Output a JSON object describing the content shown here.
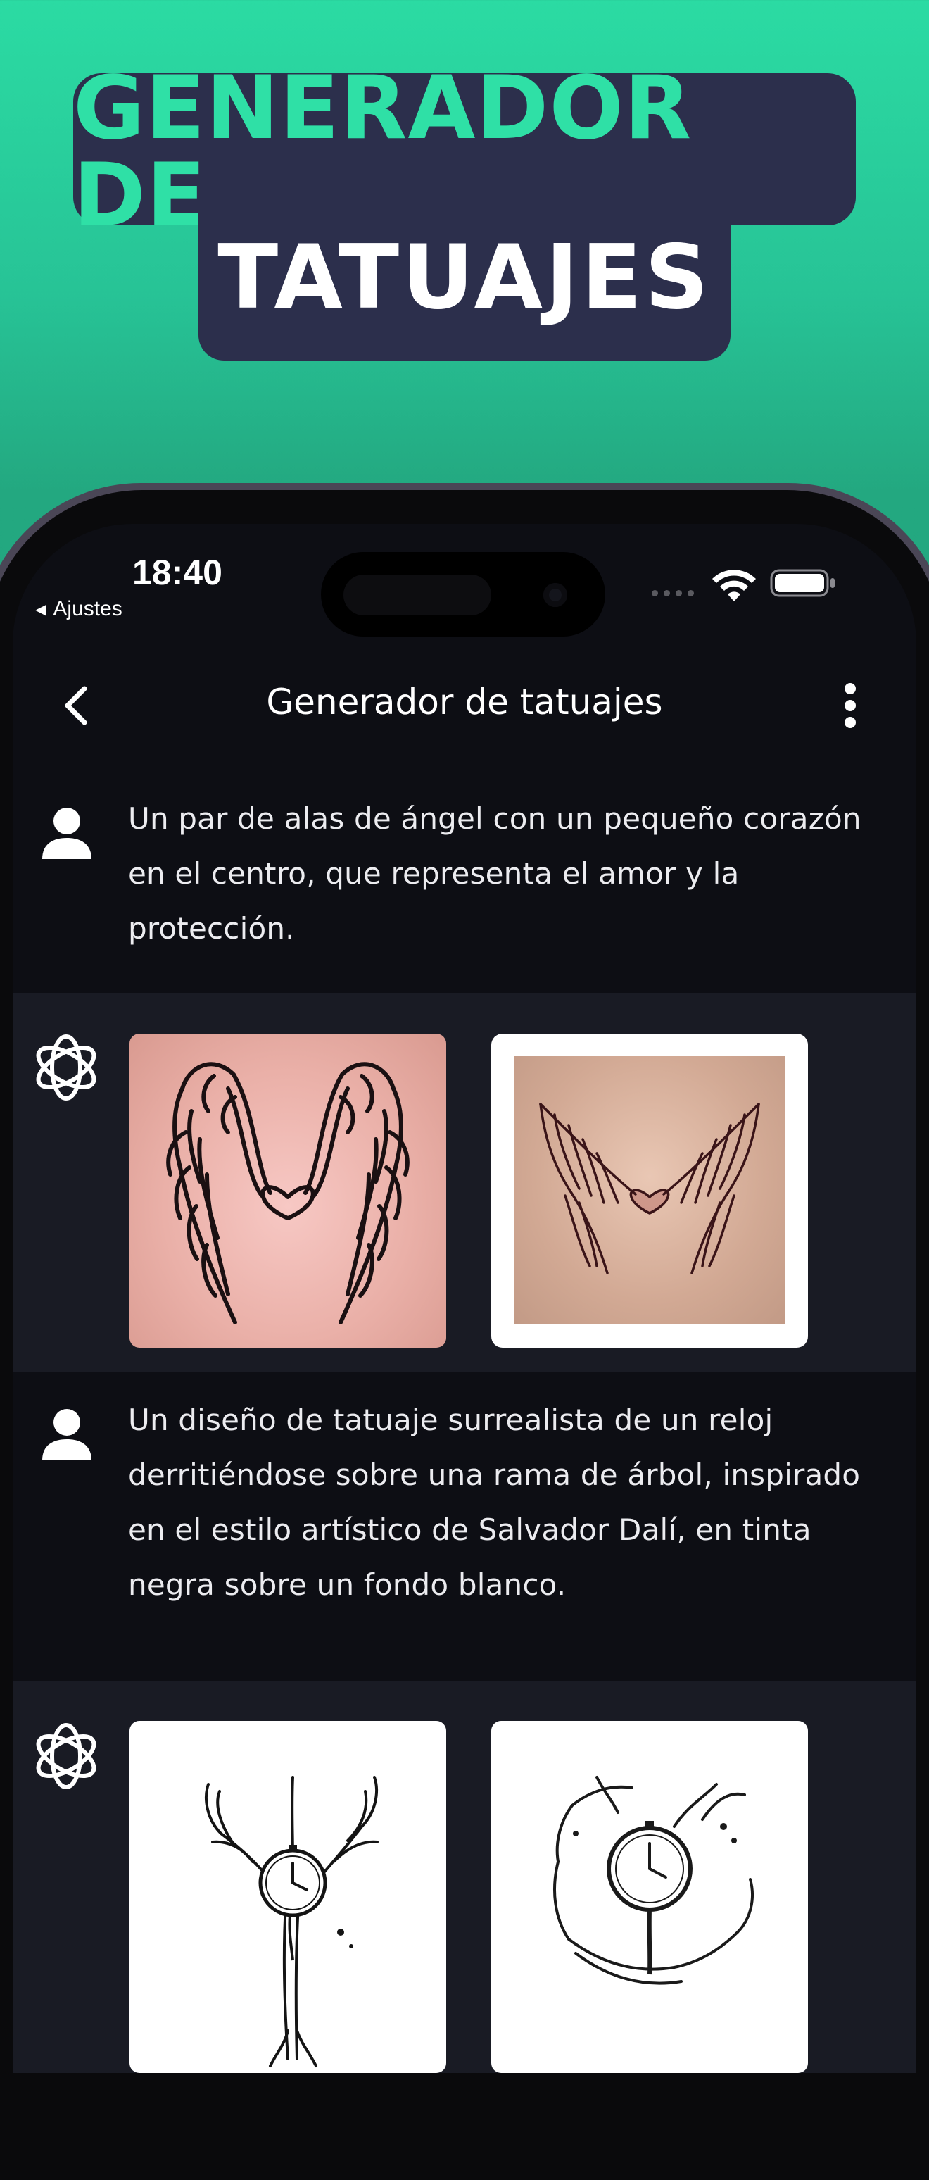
{
  "promo": {
    "headline_line1": "GENERADOR DE",
    "headline_line2": "TATUAJES"
  },
  "status_bar": {
    "time": "18:40",
    "back_app": "Ajustes"
  },
  "nav": {
    "title": "Generador de tatuajes"
  },
  "messages": [
    {
      "role": "user",
      "text": "Un par de alas de ángel con un pequeño corazón en el centro, que representa el amor y la protección."
    },
    {
      "role": "assistant",
      "images": [
        "angel-wings-tattoo-on-skin",
        "angel-wings-tattoo-framed"
      ]
    },
    {
      "role": "user",
      "text": "Un diseño de tatuaje surrealista de un reloj derritiéndose sobre una rama de árbol, inspirado en el estilo artístico de Salvador Dalí, en tinta negra sobre un fondo blanco."
    },
    {
      "role": "assistant",
      "images": [
        "melting-clock-tree-tattoo-1",
        "melting-clock-tree-tattoo-2"
      ]
    }
  ],
  "colors": {
    "background_top": "#2bdba3",
    "pill": "#2c2f4c",
    "accent": "#2fe0a6",
    "screen": "#0d0e14",
    "ai_block": "#191b24"
  },
  "icons": [
    "back-chevron-icon",
    "more-vertical-icon",
    "user-icon",
    "ai-knot-icon",
    "wifi-icon",
    "battery-icon"
  ]
}
